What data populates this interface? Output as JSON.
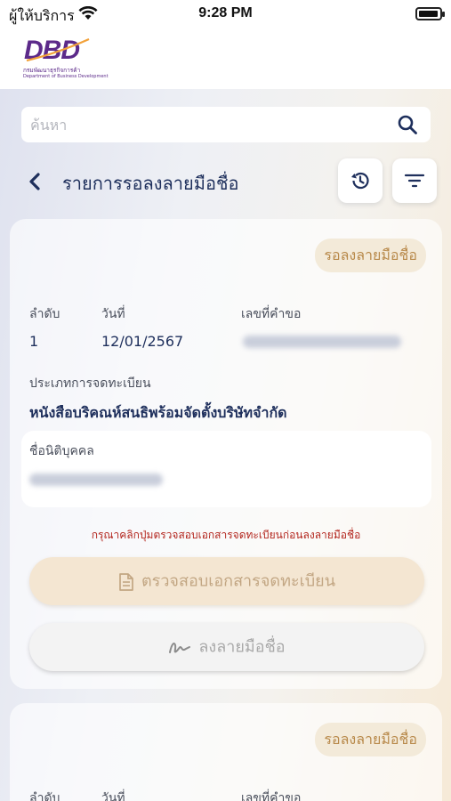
{
  "status_bar": {
    "carrier": "ผู้ให้บริการ",
    "time": "9:28 PM",
    "battery_level": 0.95
  },
  "header": {
    "logo_text": "DBD",
    "logo_subtitle_th": "กรมพัฒนาธุรกิจการค้า",
    "logo_subtitle_en": "Department of Business Development"
  },
  "search": {
    "placeholder": "ค้นหา",
    "icon": "search-icon"
  },
  "page": {
    "title": "รายการรอลงลายมือชื่อ",
    "history_icon": "history-icon",
    "filter_icon": "filter-icon"
  },
  "cards": [
    {
      "status": "รอลงลายมือชื่อ",
      "seq_label": "ลำดับ",
      "date_label": "วันที่",
      "request_no_label": "เลขที่คำขอ",
      "seq": "1",
      "date": "12/01/2567",
      "registration_type_label": "ประเภทการจดทะเบียน",
      "registration_type": "หนังสือบริคณห์สนธิพร้อมจัดตั้งบริษัทจำกัด",
      "juristic_name_label": "ชื่อนิติบุคคล",
      "warning": "กรุณาคลิกปุ่มตรวจสอบเอกสารจดทะเบียนก่อนลงลายมือชื่อ",
      "check_docs_label": "ตรวจสอบเอกสารจดทะเบียน",
      "sign_label": "ลงลายมือชื่อ"
    },
    {
      "status": "รอลงลายมือชื่อ",
      "seq_label": "ลำดับ",
      "date_label": "วันที่",
      "request_no_label": "เลขที่คำขอ"
    }
  ],
  "colors": {
    "navy": "#1e2f5c",
    "badge_bg": "#f3ead9",
    "badge_text": "#b8894a",
    "warning": "#b3261e",
    "logo_purple": "#5c2a8a"
  }
}
